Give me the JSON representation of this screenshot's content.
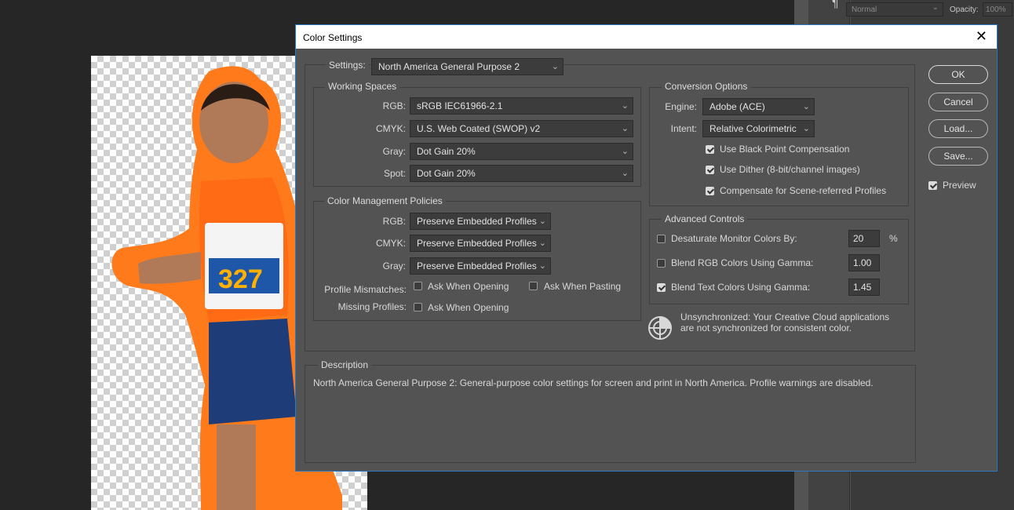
{
  "workspace": {
    "blend_mode": "Normal",
    "opacity_label": "Opacity:",
    "opacity_value": "100%"
  },
  "dialog": {
    "title": "Color Settings",
    "settings_label": "Settings:",
    "settings_value": "North America General Purpose 2",
    "working_spaces": {
      "legend": "Working Spaces",
      "rows": [
        {
          "label": "RGB:",
          "value": "sRGB IEC61966-2.1"
        },
        {
          "label": "CMYK:",
          "value": "U.S. Web Coated (SWOP) v2"
        },
        {
          "label": "Gray:",
          "value": "Dot Gain 20%"
        },
        {
          "label": "Spot:",
          "value": "Dot Gain 20%"
        }
      ]
    },
    "policies": {
      "legend": "Color Management Policies",
      "rows": [
        {
          "label": "RGB:",
          "value": "Preserve Embedded Profiles"
        },
        {
          "label": "CMYK:",
          "value": "Preserve Embedded Profiles"
        },
        {
          "label": "Gray:",
          "value": "Preserve Embedded Profiles"
        }
      ],
      "mismatch_label": "Profile Mismatches:",
      "ask_opening": "Ask When Opening",
      "ask_pasting": "Ask When Pasting",
      "missing_label": "Missing Profiles:",
      "missing_ask_opening": "Ask When Opening"
    },
    "conversion": {
      "legend": "Conversion Options",
      "engine_label": "Engine:",
      "engine_value": "Adobe (ACE)",
      "intent_label": "Intent:",
      "intent_value": "Relative Colorimetric",
      "black_point": "Use Black Point Compensation",
      "dither": "Use Dither (8-bit/channel images)",
      "scene_referred": "Compensate for Scene-referred Profiles"
    },
    "advanced": {
      "legend": "Advanced Controls",
      "desaturate_label": "Desaturate Monitor Colors By:",
      "desaturate_value": "20",
      "desaturate_unit": "%",
      "blend_rgb_label": "Blend RGB Colors Using Gamma:",
      "blend_rgb_value": "1.00",
      "blend_text_label": "Blend Text Colors Using Gamma:",
      "blend_text_value": "1.45"
    },
    "sync_message_line1": "Unsynchronized: Your Creative Cloud applications",
    "sync_message_line2": "are not synchronized for consistent color.",
    "description": {
      "legend": "Description",
      "text": "North America General Purpose 2:  General-purpose color settings for screen and print in North America. Profile warnings are disabled."
    },
    "buttons": {
      "ok": "OK",
      "cancel": "Cancel",
      "load": "Load...",
      "save": "Save..."
    },
    "preview_label": "Preview"
  }
}
